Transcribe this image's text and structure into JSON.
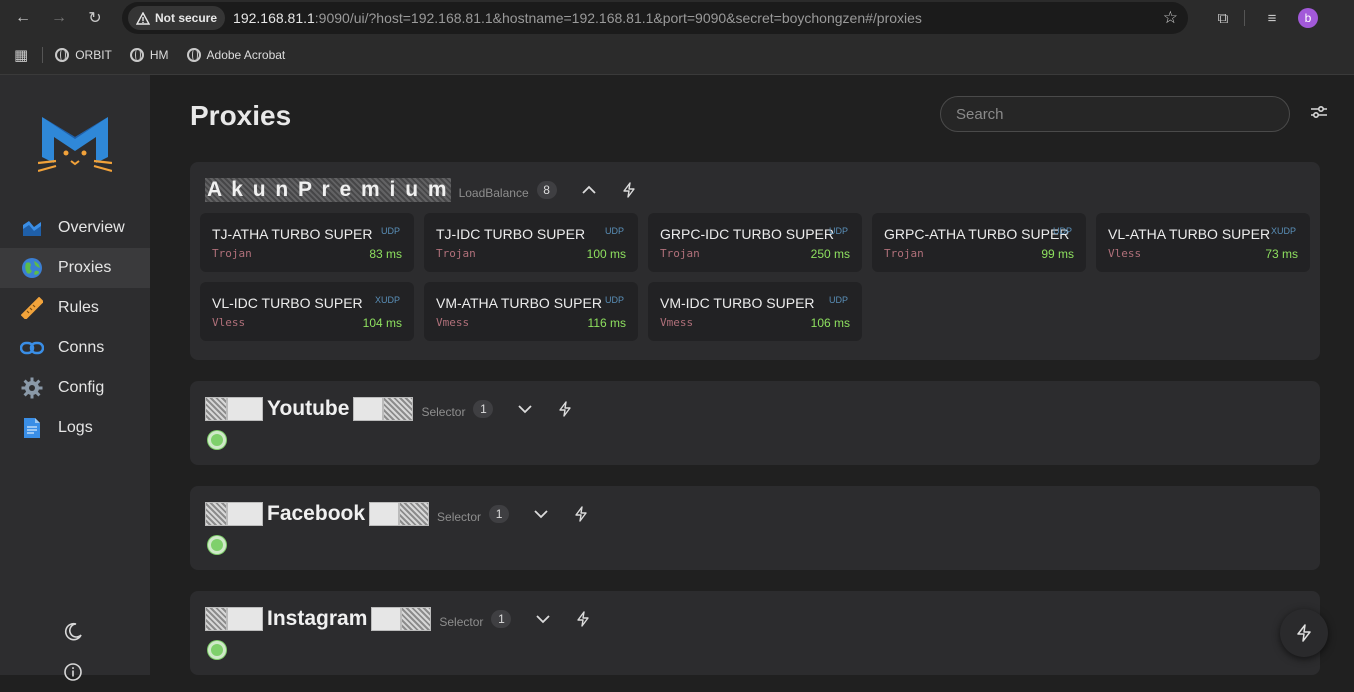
{
  "browser": {
    "security_label": "Not secure",
    "url_host": "192.168.81.1",
    "url_rest": ":9090/ui/?host=192.168.81.1&hostname=192.168.81.1&port=9090&secret=boychongzen#/proxies",
    "avatar_letter": "b",
    "bookmarks": [
      {
        "label": "ORBIT"
      },
      {
        "label": "HM"
      },
      {
        "label": "Adobe Acrobat"
      }
    ]
  },
  "sidebar": {
    "items": [
      {
        "label": "Overview",
        "icon": "overview-icon"
      },
      {
        "label": "Proxies",
        "icon": "globe-icon"
      },
      {
        "label": "Rules",
        "icon": "ruler-icon"
      },
      {
        "label": "Conns",
        "icon": "link-icon"
      },
      {
        "label": "Config",
        "icon": "gear-icon"
      },
      {
        "label": "Logs",
        "icon": "document-icon"
      }
    ]
  },
  "page": {
    "title": "Proxies",
    "search_placeholder": "Search"
  },
  "groups": [
    {
      "name": "A k u n   P r e m i u m",
      "type": "LoadBalance",
      "count": "8",
      "expanded": true,
      "proxies": [
        {
          "name": "TJ-ATHA TURBO SUPER",
          "udp": "UDP",
          "protocol": "Trojan",
          "latency": "83 ms"
        },
        {
          "name": "TJ-IDC TURBO SUPER",
          "udp": "UDP",
          "protocol": "Trojan",
          "latency": "100 ms"
        },
        {
          "name": "GRPC-IDC TURBO SUPER",
          "udp": "UDP",
          "protocol": "Trojan",
          "latency": "250 ms"
        },
        {
          "name": "GRPC-ATHA TURBO SUPER",
          "udp": "UDP",
          "protocol": "Trojan",
          "latency": "99 ms"
        },
        {
          "name": "VL-ATHA TURBO SUPER",
          "udp": "XUDP",
          "protocol": "Vless",
          "latency": "73 ms"
        },
        {
          "name": "VL-IDC TURBO SUPER",
          "udp": "XUDP",
          "protocol": "Vless",
          "latency": "104 ms"
        },
        {
          "name": "VM-ATHA TURBO SUPER",
          "udp": "UDP",
          "protocol": "Vmess",
          "latency": "116 ms"
        },
        {
          "name": "VM-IDC TURBO SUPER",
          "udp": "UDP",
          "protocol": "Vmess",
          "latency": "106 ms"
        }
      ]
    },
    {
      "name": "Youtube",
      "type": "Selector",
      "count": "1",
      "expanded": false
    },
    {
      "name": "Facebook",
      "type": "Selector",
      "count": "1",
      "expanded": false
    },
    {
      "name": "Instagram",
      "type": "Selector",
      "count": "1",
      "expanded": false
    }
  ],
  "colors": {
    "latency_good": "#8ee05f",
    "protocol": "#b0707a",
    "udp": "#5a8fb8",
    "status_dot": "#7fd06b"
  }
}
